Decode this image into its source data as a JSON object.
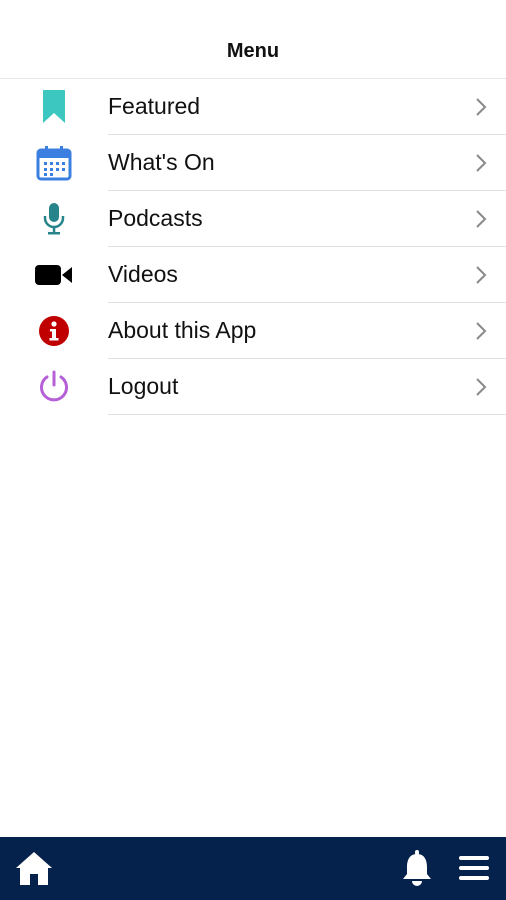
{
  "header": {
    "title": "Menu"
  },
  "menu": {
    "items": [
      {
        "label": "Featured",
        "icon": "bookmark-icon",
        "color": "#3cc8c0"
      },
      {
        "label": "What's On",
        "icon": "calendar-icon",
        "color": "#3b7fe0"
      },
      {
        "label": "Podcasts",
        "icon": "microphone-icon",
        "color": "#27848a"
      },
      {
        "label": "Videos",
        "icon": "video-camera-icon",
        "color": "#000000"
      },
      {
        "label": "About this App",
        "icon": "info-icon",
        "color": "#c00000"
      },
      {
        "label": "Logout",
        "icon": "power-icon",
        "color": "#b560d6"
      }
    ]
  },
  "bottom_bar": {
    "background": "#05224d",
    "icons": [
      "home-icon",
      "bell-icon",
      "hamburger-menu-icon"
    ]
  }
}
